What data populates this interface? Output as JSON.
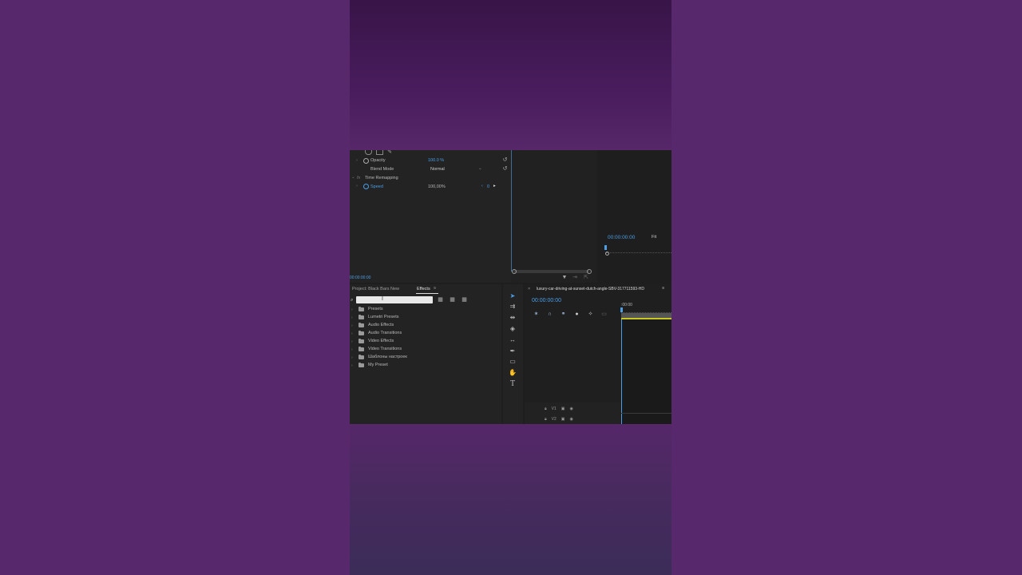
{
  "effect_controls": {
    "opacity_label": "Opacity",
    "opacity_value": "100.0 %",
    "blend_mode_label": "Blend Mode",
    "blend_mode_value": "Normal",
    "time_remapping_label": "Time Remapping",
    "speed_label": "Speed",
    "speed_value": "100,00%",
    "keyframe_value": "0",
    "timecode": "00:00:00:00"
  },
  "program_monitor": {
    "timecode": "00:00:00:00",
    "fit_value": "Fit"
  },
  "project_panel": {
    "project_tab": "Project: Black Bars New",
    "effects_tab": "Effects",
    "search_value": "",
    "items": [
      {
        "label": "Presets"
      },
      {
        "label": "Lumetri Presets"
      },
      {
        "label": "Audio Effects"
      },
      {
        "label": "Audio Transitions"
      },
      {
        "label": "Video Effects"
      },
      {
        "label": "Video Transitions"
      },
      {
        "label": "Шаблоны настроек"
      },
      {
        "label": "My Preset"
      }
    ]
  },
  "timeline": {
    "sequence_name": "luxury-car-driving-at-sunset-dutch-angle-SBV-317711593-HD",
    "timecode": "00:00:00:00",
    "ruler_start": ":00:00",
    "tracks": [
      {
        "label": "V1"
      },
      {
        "label": "V2"
      }
    ]
  },
  "colors": {
    "background": "#58286c",
    "panel": "#232323",
    "accent": "#4a9fe8",
    "clip": "#c8c820"
  }
}
